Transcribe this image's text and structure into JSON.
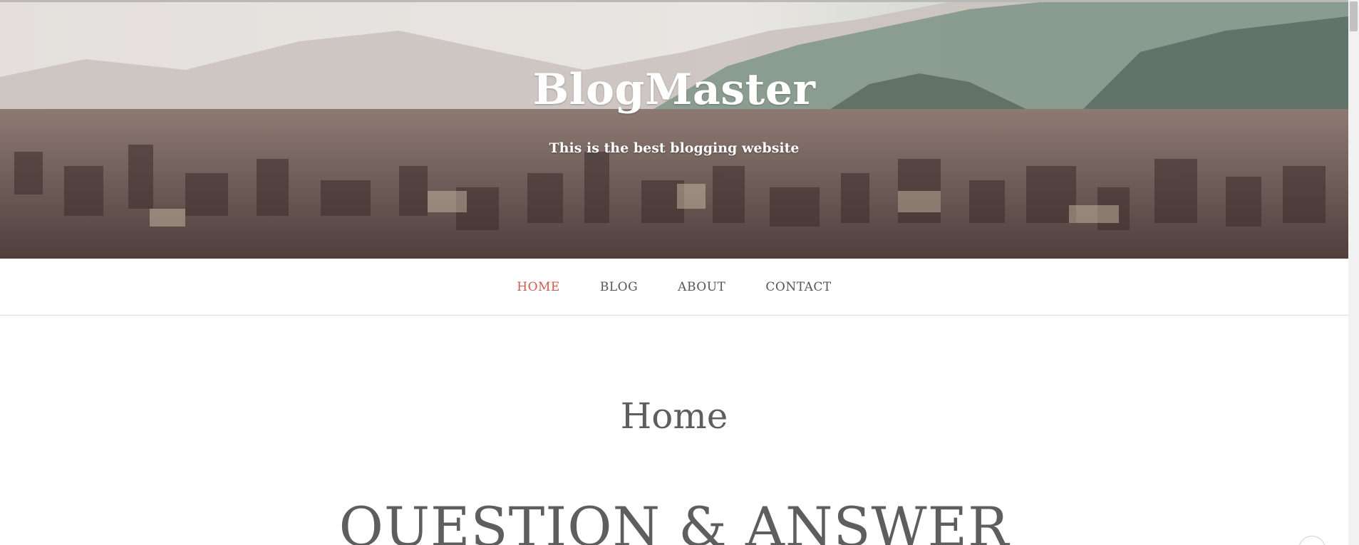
{
  "site": {
    "title": "BlogMaster",
    "tagline": "This is the best blogging website"
  },
  "nav": {
    "items": [
      {
        "label": "HOME",
        "active": true
      },
      {
        "label": "BLOG",
        "active": false
      },
      {
        "label": "ABOUT",
        "active": false
      },
      {
        "label": "CONTACT",
        "active": false
      }
    ]
  },
  "main": {
    "page_title": "Home",
    "section_title": "QUESTION & ANSWER"
  },
  "colors": {
    "accent": "#d05a4f",
    "nav_text": "#555555",
    "heading_text": "#5e5e5e"
  }
}
